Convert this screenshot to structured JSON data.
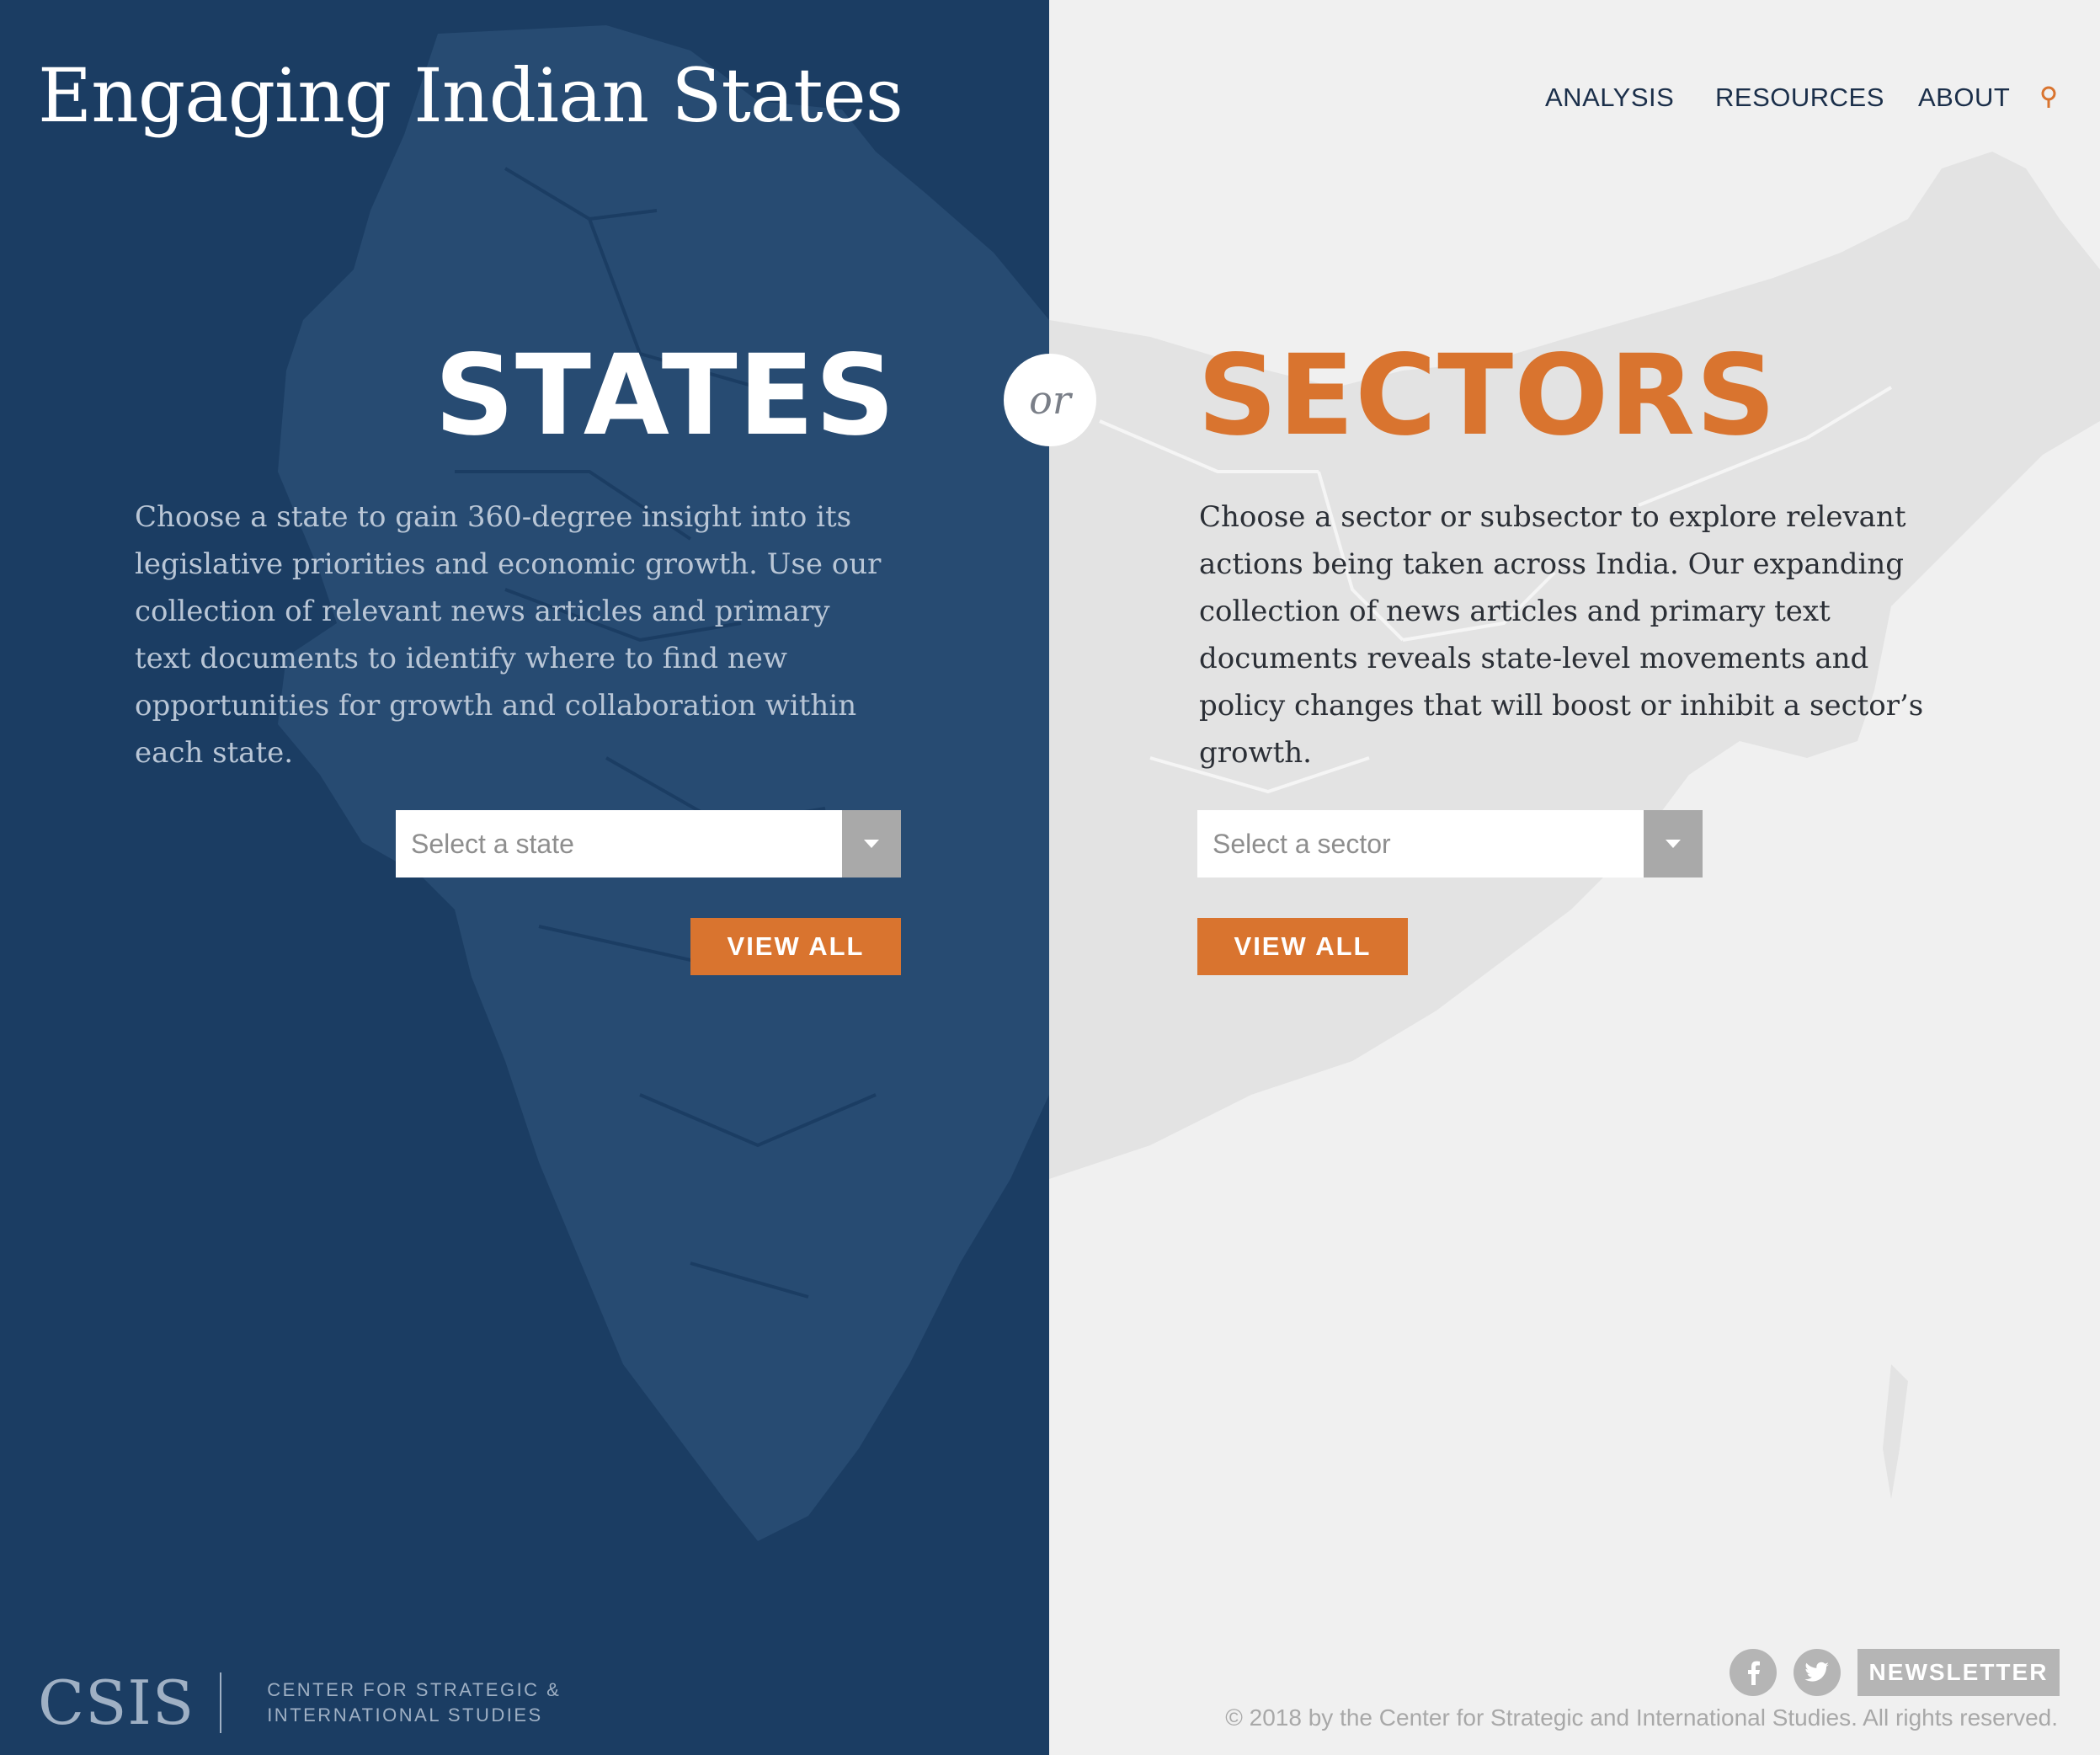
{
  "site": {
    "title": "Engaging Indian States"
  },
  "nav": {
    "items": [
      {
        "label": "ANALYSIS"
      },
      {
        "label": "RESOURCES"
      },
      {
        "label": "ABOUT"
      }
    ],
    "search_icon": "search-icon"
  },
  "states_panel": {
    "heading": "STATES",
    "description": "Choose a state to gain 360-degree insight into its legislative priorities and economic growth. Use our collection of relevant news articles and primary text documents to identify where to find new opportunities for growth and collaboration within each state.",
    "select_placeholder": "Select a state",
    "view_all_label": "VIEW ALL"
  },
  "divider": {
    "label": "or"
  },
  "sectors_panel": {
    "heading": "SECTORS",
    "description": "Choose a sector or subsector to explore relevant actions being taken across India. Our expanding collection of news articles and primary text documents reveals state-level movements and policy changes that will boost or inhibit a sector’s growth.",
    "select_placeholder": "Select a sector",
    "view_all_label": "VIEW ALL"
  },
  "footer": {
    "logo_mark": "CSIS",
    "logo_line1": "CENTER FOR STRATEGIC &",
    "logo_line2": "INTERNATIONAL STUDIES",
    "social": [
      "facebook-icon",
      "twitter-icon"
    ],
    "newsletter_label": "NEWSLETTER",
    "copyright": "© 2018 by the Center for Strategic and International Studies. All rights reserved."
  },
  "colors": {
    "left_panel": "#1b3d63",
    "right_panel": "#f0f0f0",
    "accent_orange": "#d9742f",
    "nav_text": "#1b2f4a"
  }
}
